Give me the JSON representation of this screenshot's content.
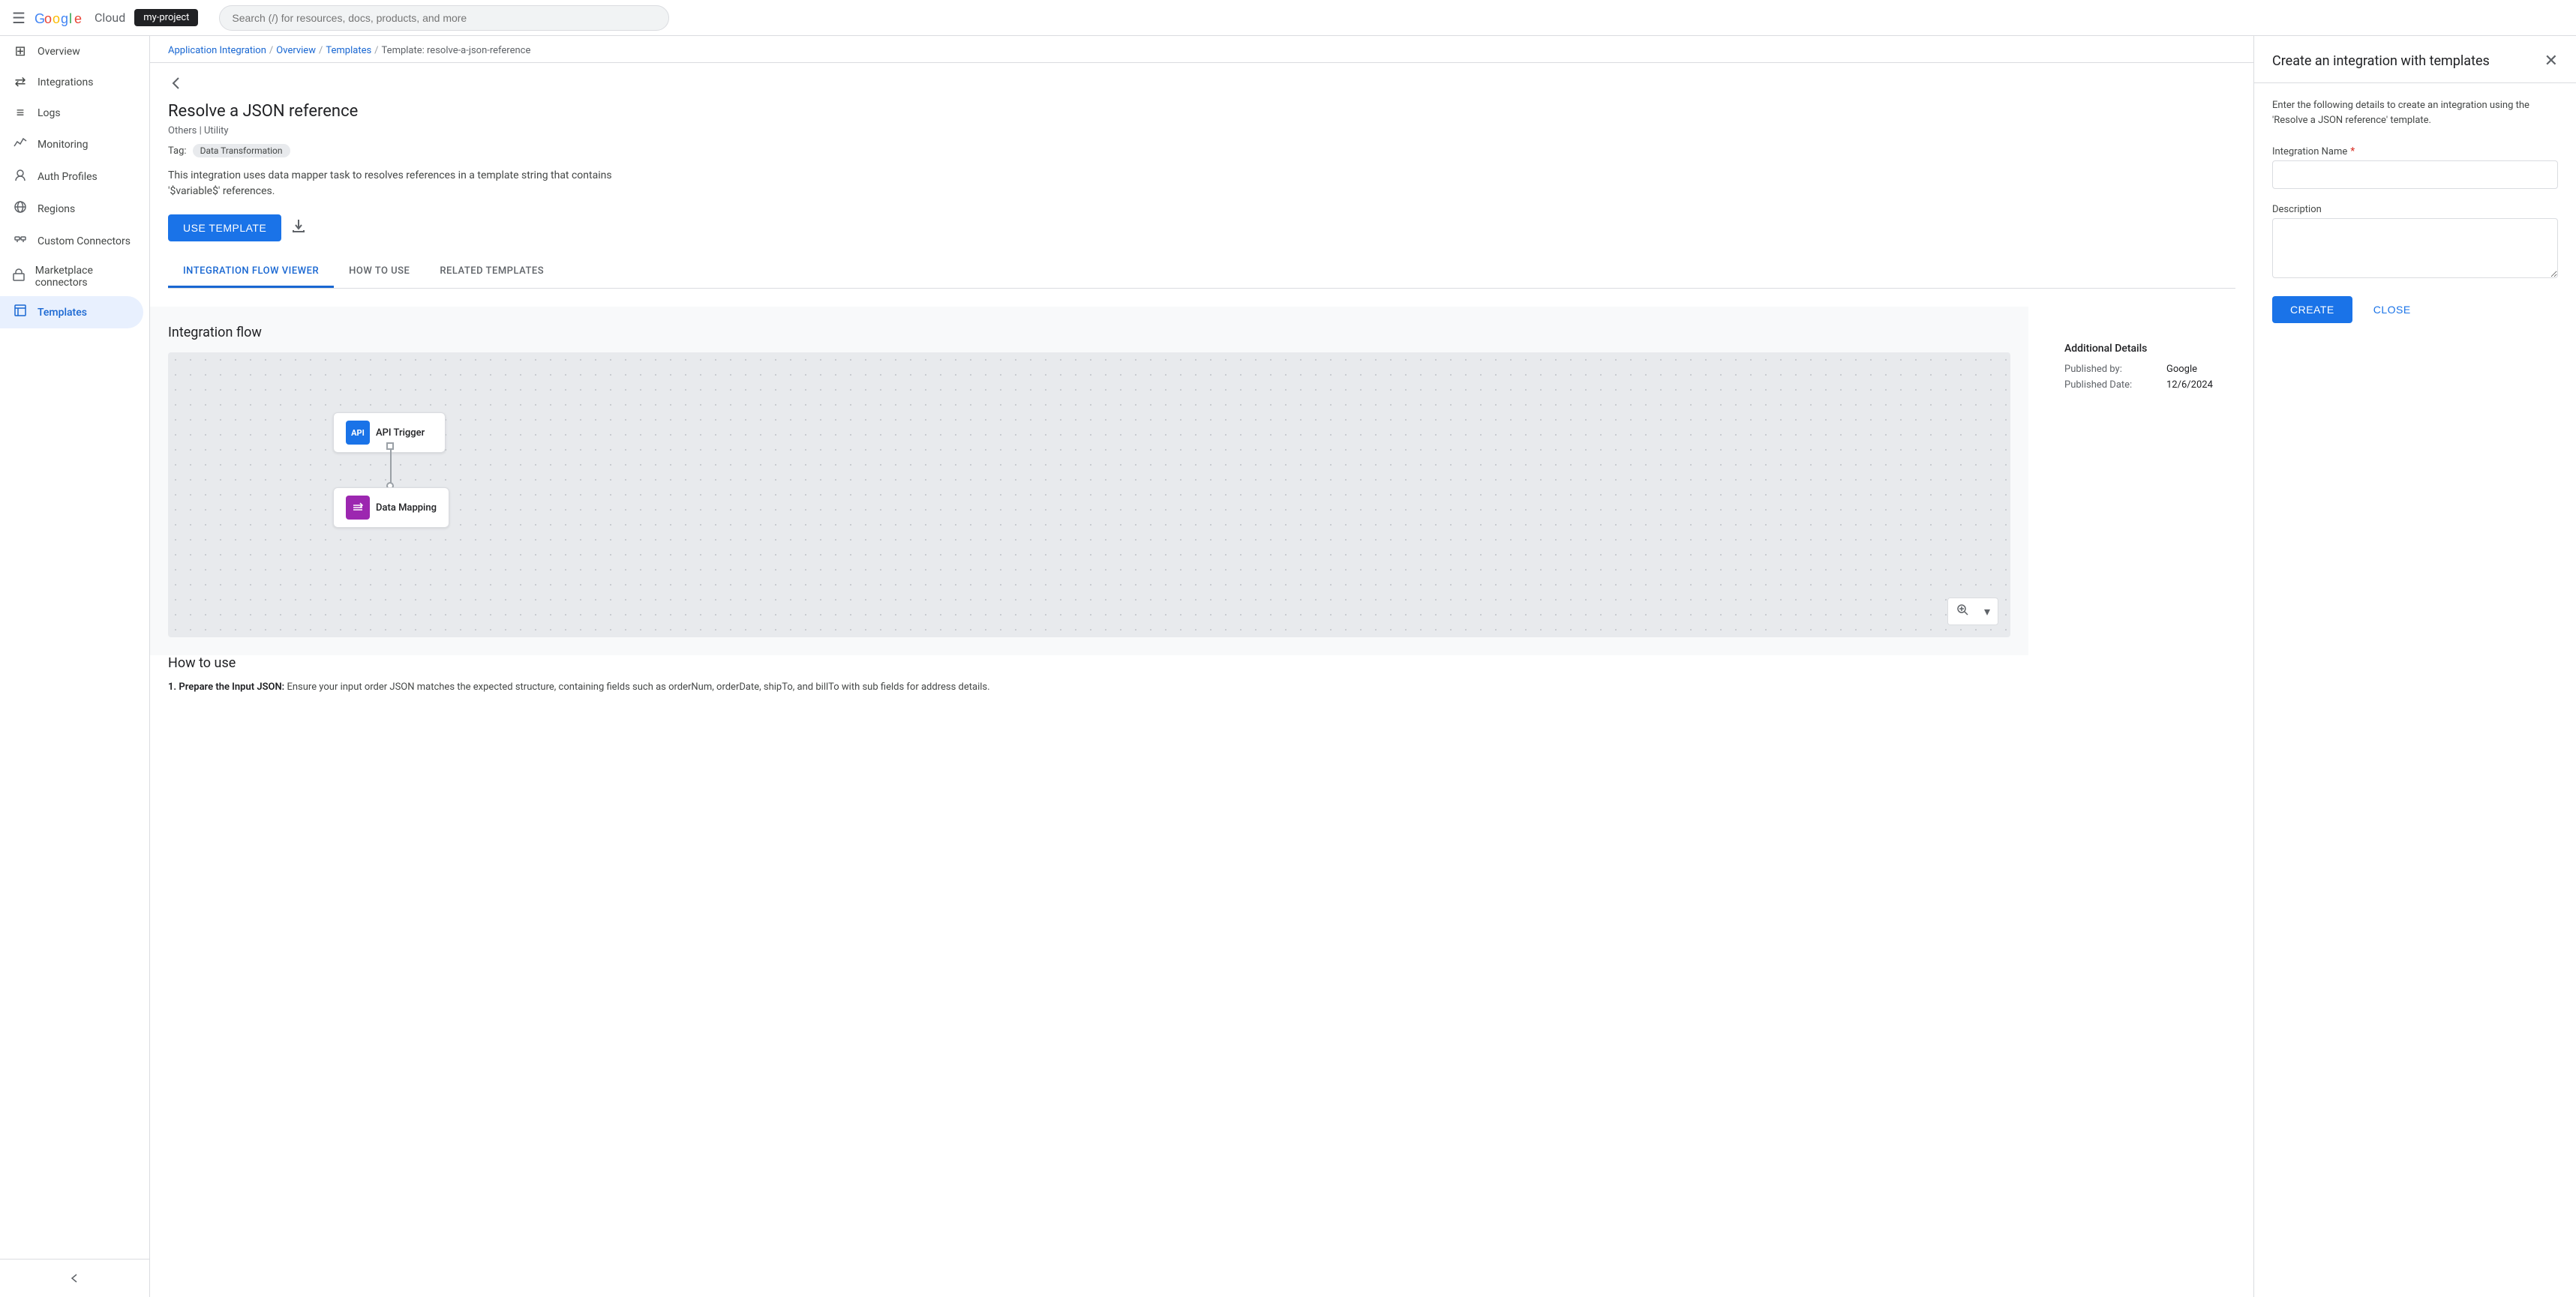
{
  "topbar": {
    "menu_icon": "☰",
    "logo_google": "Google",
    "logo_cloud": " Cloud",
    "search_placeholder": "Search (/) for resources, docs, products, and more",
    "project_name": "my-project"
  },
  "breadcrumb": {
    "items": [
      "Application Integration",
      "Overview",
      "Templates",
      "Template: resolve-a-json-reference"
    ],
    "separators": [
      "/",
      "/",
      "/"
    ]
  },
  "template": {
    "title": "Resolve a JSON reference",
    "subtitle": "Others | Utility",
    "tag_label": "Tag:",
    "tag_value": "Data Transformation",
    "description": "This integration uses data mapper task to resolves references in a template string that contains '$variable$' references.",
    "use_template_btn": "USE TEMPLATE",
    "download_icon": "⬇"
  },
  "tabs": [
    {
      "id": "flow",
      "label": "INTEGRATION FLOW VIEWER",
      "active": true
    },
    {
      "id": "howto",
      "label": "HOW TO USE",
      "active": false
    },
    {
      "id": "related",
      "label": "RELATED TEMPLATES",
      "active": false
    }
  ],
  "flow": {
    "title": "Integration flow",
    "nodes": [
      {
        "id": "api-trigger",
        "label": "API Trigger",
        "icon": "API",
        "icon_class": ""
      },
      {
        "id": "data-mapping",
        "label": "Data Mapping",
        "icon": "⇌",
        "icon_class": "mapping"
      }
    ],
    "zoom_icon": "🔍",
    "zoom_dropdown": "▾"
  },
  "additional_details": {
    "title": "Additional Details",
    "published_by_label": "Published by:",
    "published_by_value": "Google",
    "published_date_label": "Published Date:",
    "published_date_value": "12/6/2024"
  },
  "how_to_use": {
    "title": "How to use",
    "step1_label": "1.",
    "step1_bold": "Prepare the Input JSON:",
    "step1_text": " Ensure your input order JSON matches the expected structure, containing fields such as orderNum, orderDate, shipTo, and billTo with sub fields for address details."
  },
  "sidebar": {
    "items": [
      {
        "id": "overview",
        "icon": "⊞",
        "label": "Overview",
        "active": false
      },
      {
        "id": "integrations",
        "icon": "⇄",
        "label": "Integrations",
        "active": false
      },
      {
        "id": "logs",
        "icon": "≡",
        "label": "Logs",
        "active": false
      },
      {
        "id": "monitoring",
        "icon": "📈",
        "label": "Monitoring",
        "active": false
      },
      {
        "id": "auth",
        "icon": "🔒",
        "label": "Auth Profiles",
        "active": false
      },
      {
        "id": "regions",
        "icon": "🌐",
        "label": "Regions",
        "active": false
      },
      {
        "id": "connectors",
        "icon": "🔌",
        "label": "Custom Connectors",
        "active": false
      },
      {
        "id": "marketplace",
        "icon": "🛒",
        "label": "Marketplace connectors",
        "active": false
      },
      {
        "id": "templates",
        "icon": "📄",
        "label": "Templates",
        "active": true
      }
    ]
  },
  "panel": {
    "title": "Create an integration with templates",
    "description": "Enter the following details to create an integration using the 'Resolve a JSON reference' template.",
    "integration_name_label": "Integration Name",
    "integration_name_required": "*",
    "description_label": "Description",
    "create_btn": "CREATE",
    "close_btn": "CLOSE",
    "close_icon": "✕"
  }
}
